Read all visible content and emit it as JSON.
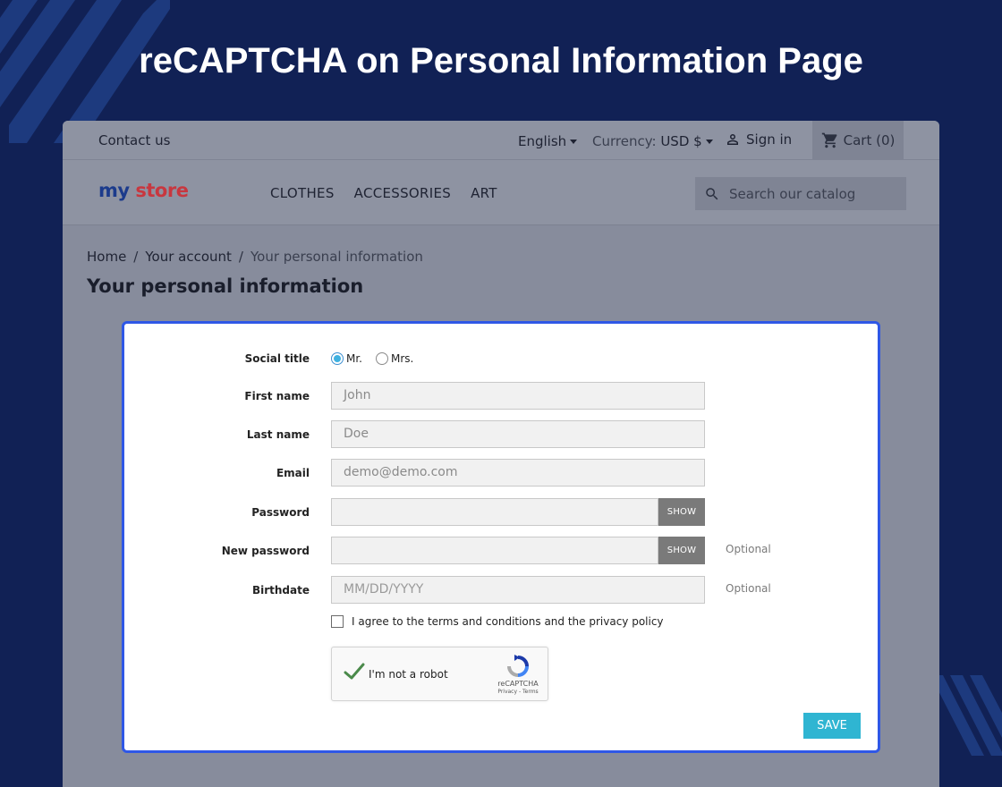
{
  "banner": {
    "title": "reCAPTCHA on Personal Information Page"
  },
  "topbar": {
    "contact": "Contact us",
    "language": "English",
    "currency_label": "Currency:",
    "currency_value": "USD $",
    "signin": "Sign in",
    "cart": "Cart (0)"
  },
  "navbar": {
    "logo_part1": "my",
    "logo_part2": "store",
    "menu": [
      "CLOTHES",
      "ACCESSORIES",
      "ART"
    ],
    "search_placeholder": "Search our catalog"
  },
  "breadcrumb": [
    "Home",
    "Your account",
    "Your personal information"
  ],
  "page_title": "Your personal information",
  "form": {
    "social_title_label": "Social title",
    "social_options": [
      "Mr.",
      "Mrs."
    ],
    "social_selected": "Mr.",
    "first_name_label": "First name",
    "first_name_value": "John",
    "last_name_label": "Last name",
    "last_name_value": "Doe",
    "email_label": "Email",
    "email_value": "demo@demo.com",
    "password_label": "Password",
    "new_password_label": "New password",
    "show_label": "SHOW",
    "optional_label": "Optional",
    "birthdate_label": "Birthdate",
    "birthdate_placeholder": "MM/DD/YYYY",
    "agree_text": "I agree to the terms and conditions and the privacy policy",
    "save_label": "SAVE"
  },
  "captcha": {
    "text": "I'm not a robot",
    "brand": "reCAPTCHA",
    "links": "Privacy - Terms",
    "checked": true
  },
  "colors": {
    "background": "#112155",
    "card_border": "#2f57e6",
    "save_button": "#2fb5d2",
    "check_green": "#4a8a4a"
  }
}
